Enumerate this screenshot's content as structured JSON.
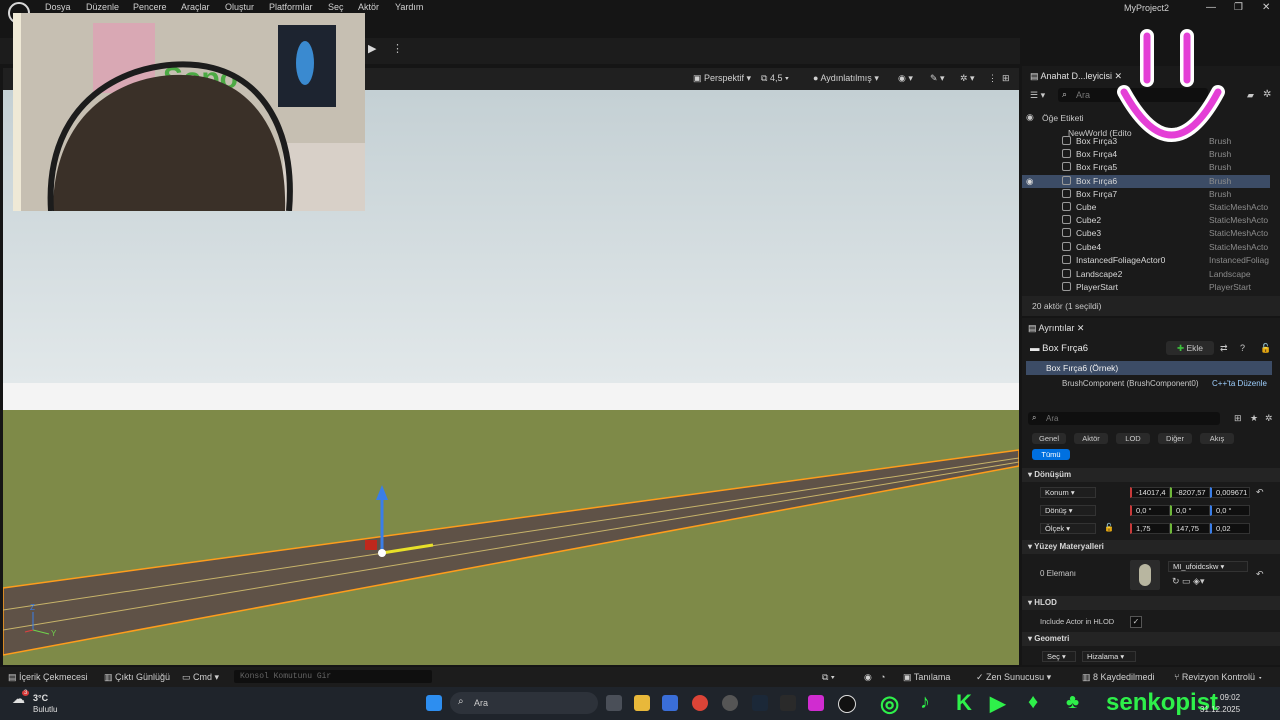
{
  "menu": [
    "Dosya",
    "Düzenle",
    "Pencere",
    "Araçlar",
    "Oluştur",
    "Platformlar",
    "Seç",
    "Aktör",
    "Yardım"
  ],
  "project_title": "MyProject2",
  "window_controls": {
    "minimize": "—",
    "maximize": "❐",
    "close": "✕"
  },
  "viewport": {
    "perspective": "Perspektif",
    "fov": "4,5",
    "lit": "Aydınlatılmış",
    "axis_z": "Z",
    "axis_y": "Y"
  },
  "outliner": {
    "tab": "Anahat D...leyicisi",
    "search_placeholder": "Ara",
    "col_label": "Öğe Etiketi",
    "world": "NewWorld (Edito",
    "rows": [
      {
        "name": "Box Fırça3",
        "type": "Brush"
      },
      {
        "name": "Box Fırça4",
        "type": "Brush"
      },
      {
        "name": "Box Fırça5",
        "type": "Brush"
      },
      {
        "name": "Box Fırça6",
        "type": "Brush",
        "selected": true
      },
      {
        "name": "Box Fırça7",
        "type": "Brush"
      },
      {
        "name": "Cube",
        "type": "StaticMeshActo"
      },
      {
        "name": "Cube2",
        "type": "StaticMeshActo"
      },
      {
        "name": "Cube3",
        "type": "StaticMeshActo"
      },
      {
        "name": "Cube4",
        "type": "StaticMeshActo"
      },
      {
        "name": "InstancedFoliageActor0",
        "type": "InstancedFoliag"
      },
      {
        "name": "Landscape2",
        "type": "Landscape"
      },
      {
        "name": "PlayerStart",
        "type": "PlayerStart"
      }
    ],
    "footer": "20 aktör (1 seçildi)"
  },
  "details": {
    "tab": "Ayrıntılar",
    "actor_name": "Box Fırça6",
    "add_label": "Ekle",
    "instance": "Box Fırça6 (Örnek)",
    "component": "BrushComponent (BrushComponent0)",
    "cpp_link": "C++'ta Düzenle",
    "search_placeholder": "Ara",
    "filters": [
      "Genel",
      "Aktör",
      "LOD",
      "Diğer",
      "Akış",
      "Tümü"
    ],
    "transform_section": "Dönüşüm",
    "location_label": "Konum",
    "rotation_label": "Dönüş",
    "scale_label": "Ölçek",
    "location": [
      "-14017,4",
      "-8207,57",
      "0,009671"
    ],
    "rotation": [
      "0,0 °",
      "0,0 °",
      "0,0 °"
    ],
    "scale": [
      "1,75",
      "147,75",
      "0,02"
    ],
    "materials_section": "Yüzey Materyalleri",
    "elements_label": "0 Elemanı",
    "material_name": "MI_ufoidcskw",
    "hlod_section": "HLOD",
    "hlod_include": "Include Actor in HLOD",
    "geometry_section": "Geometri",
    "select_label": "Seç",
    "align_label": "Hizalama"
  },
  "statusbar": {
    "content_drawer": "İçerik Çekmecesi",
    "output_log": "Çıktı Günlüğü",
    "cmd": "Cmd",
    "console_placeholder": "Konsol Komutunu Gir",
    "trace": "Tanılama",
    "zen": "Zen Sunucusu",
    "saved": "8 Kaydedilmedi",
    "revision": "Revizyon Kontrolü"
  },
  "taskbar": {
    "weather_temp": "3°C",
    "weather_desc": "Bulutlu",
    "search": "Ara",
    "time": "09:02",
    "date": "31.12.2025",
    "notif_count": "3"
  },
  "overlay": {
    "channel": "senkopist"
  },
  "colors": {
    "accent": "#0070e0",
    "selection": "#3c4c66",
    "social": "#2ef04a",
    "smiley": "#e43fd6"
  }
}
